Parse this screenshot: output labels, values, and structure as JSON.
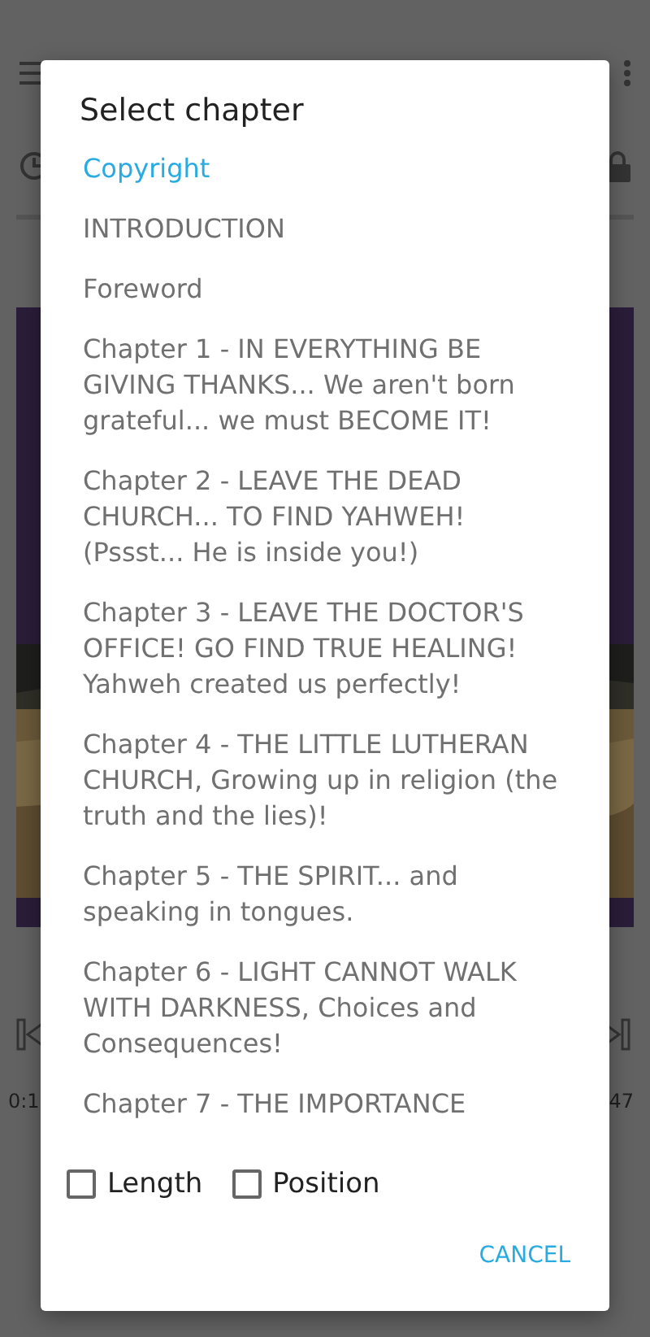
{
  "player": {
    "elapsed": "0:1",
    "remaining": "47"
  },
  "dialog": {
    "title": "Select chapter",
    "chapters": [
      {
        "label": "Copyright",
        "selected": true
      },
      {
        "label": "INTRODUCTION",
        "selected": false
      },
      {
        "label": "Foreword",
        "selected": false
      },
      {
        "label": "Chapter 1 - IN EVERYTHING BE GIVING THANKS... We aren't born grateful... we must BECOME IT!",
        "selected": false
      },
      {
        "label": "Chapter 2 - LEAVE THE DEAD CHURCH... TO FIND YAHWEH! (Pssst... He is inside you!)",
        "selected": false
      },
      {
        "label": "Chapter 3 - LEAVE THE DOCTOR'S OFFICE! GO FIND TRUE HEALING! Yahweh created us perfectly!",
        "selected": false
      },
      {
        "label": "Chapter 4 - THE LITTLE LUTHERAN CHURCH, Growing up in religion (the truth and the lies)!",
        "selected": false
      },
      {
        "label": "Chapter 5 - THE SPIRIT... and speaking in tongues.",
        "selected": false
      },
      {
        "label": "Chapter 6 - LIGHT CANNOT WALK WITH DARKNESS, Choices and Consequences!",
        "selected": false
      },
      {
        "label": "Chapter 7 - THE IMPORTANCE",
        "selected": false
      }
    ],
    "options": [
      {
        "label": "Length",
        "checked": false
      },
      {
        "label": "Position",
        "checked": false
      }
    ],
    "cancel": "CANCEL"
  }
}
